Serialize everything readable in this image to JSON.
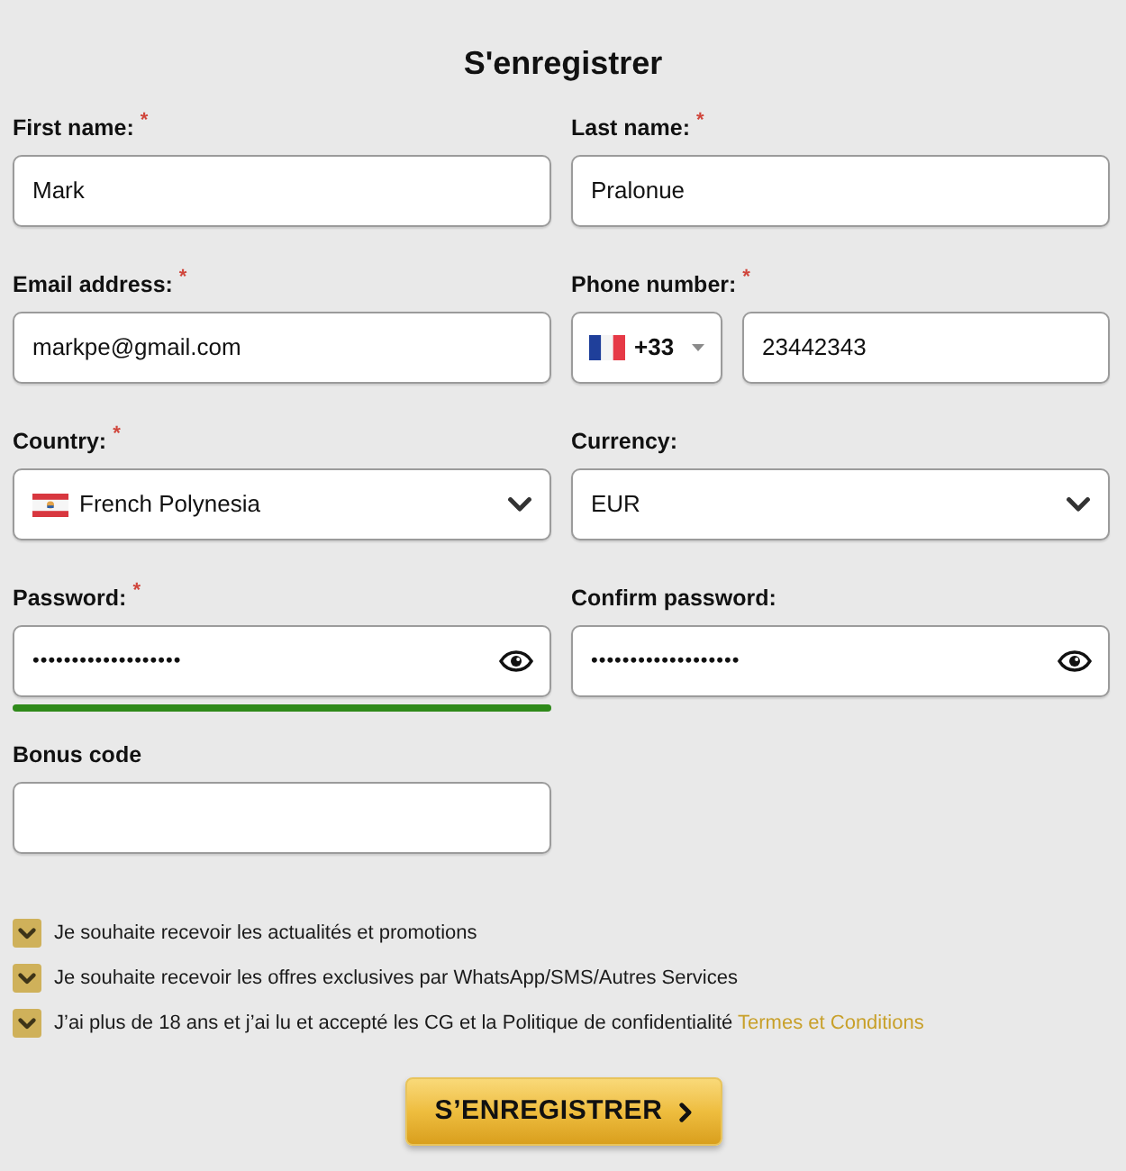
{
  "title": "S'enregistrer",
  "fields": [
    {
      "kind": "text",
      "label": "First name: $^{*}$",
      "value": "Mark"
    },
    {
      "kind": "text",
      "label": "Last name: $^{*}$",
      "value": "Pralonue"
    },
    {
      "kind": "text",
      "label": "Email address: $^{*}$",
      "value": "markpe@gmail.com"
    },
    {
      "kind": "phone",
      "label": "Phone number: $^{*}$",
      "dial_code": "+33",
      "value": "23442343"
    },
    {
      "kind": "country",
      "label": "Country: $^{*}$",
      "value": "French Polynesia"
    },
    {
      "kind": "select",
      "label": "Currency:",
      "value": "EUR"
    },
    {
      "kind": "password",
      "label": "Password: $^{*}$",
      "value": "•••••••••••••••••••",
      "strength": {
        "level": 1
      }
    },
    {
      "kind": "password",
      "label": "Confirm password:",
      "value": "•••••••••••••••••••"
    },
    {
      "kind": "text",
      "label": "Bonus code"
    }
  ],
  "consents": [
    {
      "text": "Je souhaite recevoir les actualités et promotions",
      "checked": true
    },
    {
      "text": "Je souhaite recevoir les offres exclusives par WhatsApp/SMS/Autres Services",
      "checked": true
    },
    {
      "text": "J’ai plus de 18 ans et j’ai lu et accepté les CG et la Politique de confidentialité",
      "link": "Termes et Conditions",
      "checked": true
    }
  ],
  "submit_button": "S’ENREGISTRER"
}
